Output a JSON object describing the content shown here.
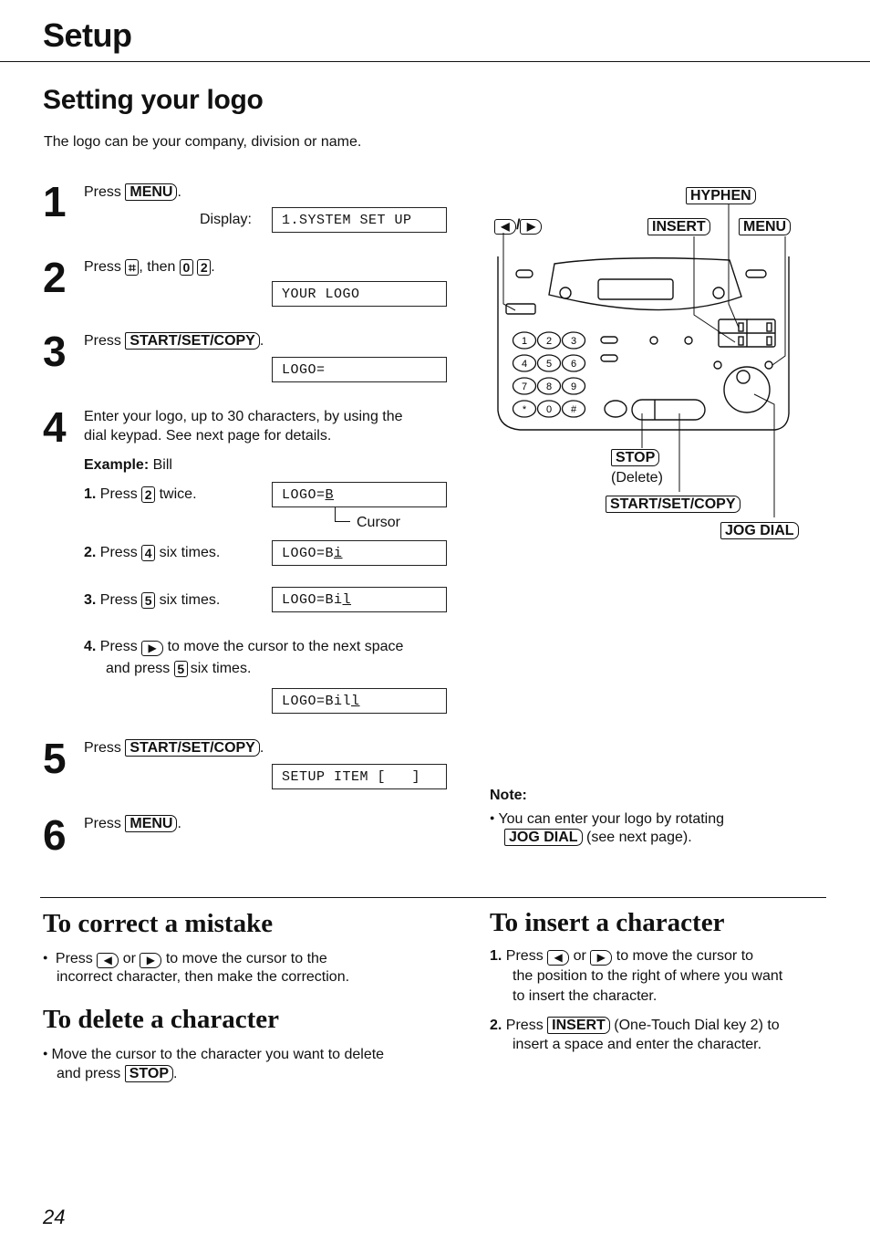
{
  "header": {
    "section": "Setup"
  },
  "title": "Setting your logo",
  "intro": "The logo can be your company, division or name.",
  "steps": [
    {
      "num": "1",
      "press": "Press",
      "key": "MENU",
      "after": ".",
      "display_label": "Display:",
      "display": "1.SYSTEM SET UP"
    },
    {
      "num": "2",
      "press": "Press",
      "key1": "⌗",
      "mid": ", then",
      "key2": "0",
      "key3": "2",
      "after": ".",
      "display": "YOUR LOGO"
    },
    {
      "num": "3",
      "press": "Press",
      "key": "START/SET/COPY",
      "after": ".",
      "display": "LOGO="
    },
    {
      "num": "4",
      "text1": "Enter your logo, up to 30 characters, by using the",
      "text2": "dial keypad. See next page for details.",
      "example_label": "Example:",
      "example_value": "Bill",
      "substeps": [
        {
          "num": "1.",
          "press": "Press",
          "key": "2",
          "after": "twice.",
          "display_prefix": "LOGO=",
          "display_cursor": "B"
        },
        {
          "num": "2.",
          "press": "Press",
          "key": "4",
          "after": "six times.",
          "display_prefix": "LOGO=B",
          "display_cursor": "i"
        },
        {
          "num": "3.",
          "press": "Press",
          "key": "5",
          "after": "six times.",
          "display_prefix": "LOGO=Bi",
          "display_cursor": "l"
        },
        {
          "num": "4.",
          "press": "Press",
          "key": "▶",
          "after": "to move the cursor to the next space",
          "line2_pre": "and press",
          "key2": "5",
          "line2_post": "six times.",
          "display_prefix": "LOGO=Bil",
          "display_cursor": "l"
        }
      ],
      "cursor_label": "Cursor"
    },
    {
      "num": "5",
      "press": "Press",
      "key": "START/SET/COPY",
      "after": ".",
      "display": "SETUP ITEM [   ]"
    },
    {
      "num": "6",
      "press": "Press",
      "key": "MENU",
      "after": "."
    }
  ],
  "diagram": {
    "labels": {
      "arrows": "◀/▶",
      "hyphen": "HYPHEN",
      "insert": "INSERT",
      "menu": "MENU",
      "stop": "STOP",
      "delete": "(Delete)",
      "start": "START/SET/COPY",
      "jog": "JOG DIAL"
    },
    "keypad": [
      "1",
      "2",
      "3",
      "4",
      "5",
      "6",
      "7",
      "8",
      "9",
      "*",
      "0",
      "#"
    ]
  },
  "note": {
    "title": "Note:",
    "line1": "You can enter your logo by rotating",
    "key": "JOG DIAL",
    "line2": "(see next page)."
  },
  "correct": {
    "title": "To correct a mistake",
    "press": "Press",
    "or": "or",
    "line1_rest": "to move the cursor to the",
    "line2": "incorrect character, then make the correction."
  },
  "delete": {
    "title": "To delete a character",
    "line1": "Move the cursor to the character you want to delete",
    "line2_pre": "and press",
    "key": "STOP",
    "after": "."
  },
  "insert": {
    "title": "To insert a character",
    "items": [
      {
        "num": "1.",
        "press": "Press",
        "or": "or",
        "rest": "to move the cursor to",
        "line2": "the position to the right of where you want",
        "line3": "to insert the character."
      },
      {
        "num": "2.",
        "press": "Press",
        "key": "INSERT",
        "rest": "(One-Touch Dial key 2) to",
        "line2": "insert a space and enter the character."
      }
    ]
  },
  "page_number": "24"
}
